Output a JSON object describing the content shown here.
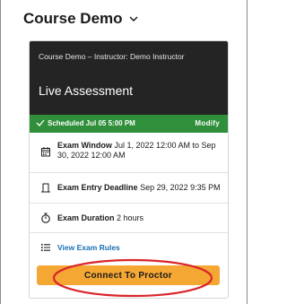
{
  "header": {
    "course_title": "Course Demo"
  },
  "card": {
    "instructor_line": "Course Demo – Instructor: Demo Instructor",
    "assessment_title": "Live Assessment",
    "status": {
      "scheduled": "Scheduled Jul 05 5:00 PM",
      "modify": "Modify",
      "color": "#2f8f3a"
    },
    "rows": [
      {
        "label": "Exam Window",
        "value": "Jul 1, 2022 12:00 AM to Sep 30, 2022 12:00 AM",
        "icon": "calendar-icon"
      },
      {
        "label": "Exam Entry Deadline",
        "value": "Sep 29, 2022 9:35 PM",
        "icon": "deadline-icon"
      },
      {
        "label": "Exam Duration",
        "value": "2 hours",
        "icon": "stopwatch-icon"
      },
      {
        "label": "View Exam Rules",
        "icon": "list-icon"
      }
    ],
    "connect_button": "Connect To Proctor",
    "accent": "#f5a733",
    "annotation_color": "#d9262b"
  }
}
